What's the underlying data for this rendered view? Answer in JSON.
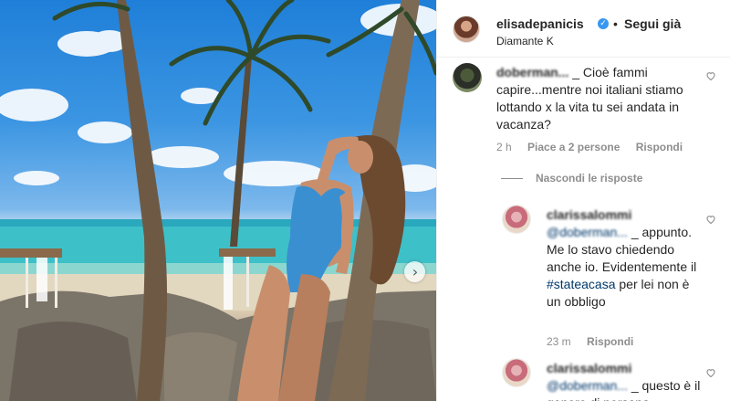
{
  "post": {
    "username": "elisadepanicis",
    "verified": true,
    "separator": "•",
    "follow_label": "Segui già",
    "location": "Diamante K"
  },
  "comments": [
    {
      "username_blurred": "doberman...",
      "text": "_ Cioè fammi capire...mentre noi italiani stiamo lottando x la vita tu sei andata in vacanza?",
      "time": "2 h",
      "likes": "Piace a 2 persone",
      "reply": "Rispondi"
    }
  ],
  "hide_replies": "Nascondi le risposte",
  "replies": [
    {
      "username_blurred": "clarissalommi",
      "mention_blurred": "@doberman...",
      "text_suffix": "_",
      "text_line2": "appunto. Me lo stavo chiedendo anche io. Evidentemente il",
      "hashtag": "#stateacasa",
      "text_after": "per lei non è un obbligo",
      "time": "23 m",
      "reply": "Rispondi"
    },
    {
      "username_blurred": "clarissalommi",
      "mention_blurred": "@doberman...",
      "text": "_ questo",
      "text_line2": "è il genere di persona"
    }
  ],
  "icons": {
    "carousel_next": "chevron-right-icon",
    "heart": "heart-outline-icon",
    "verified": "verified-badge-icon"
  },
  "colors": {
    "link": "#00376b",
    "muted": "#8e8e8e",
    "verified": "#3897f0"
  }
}
